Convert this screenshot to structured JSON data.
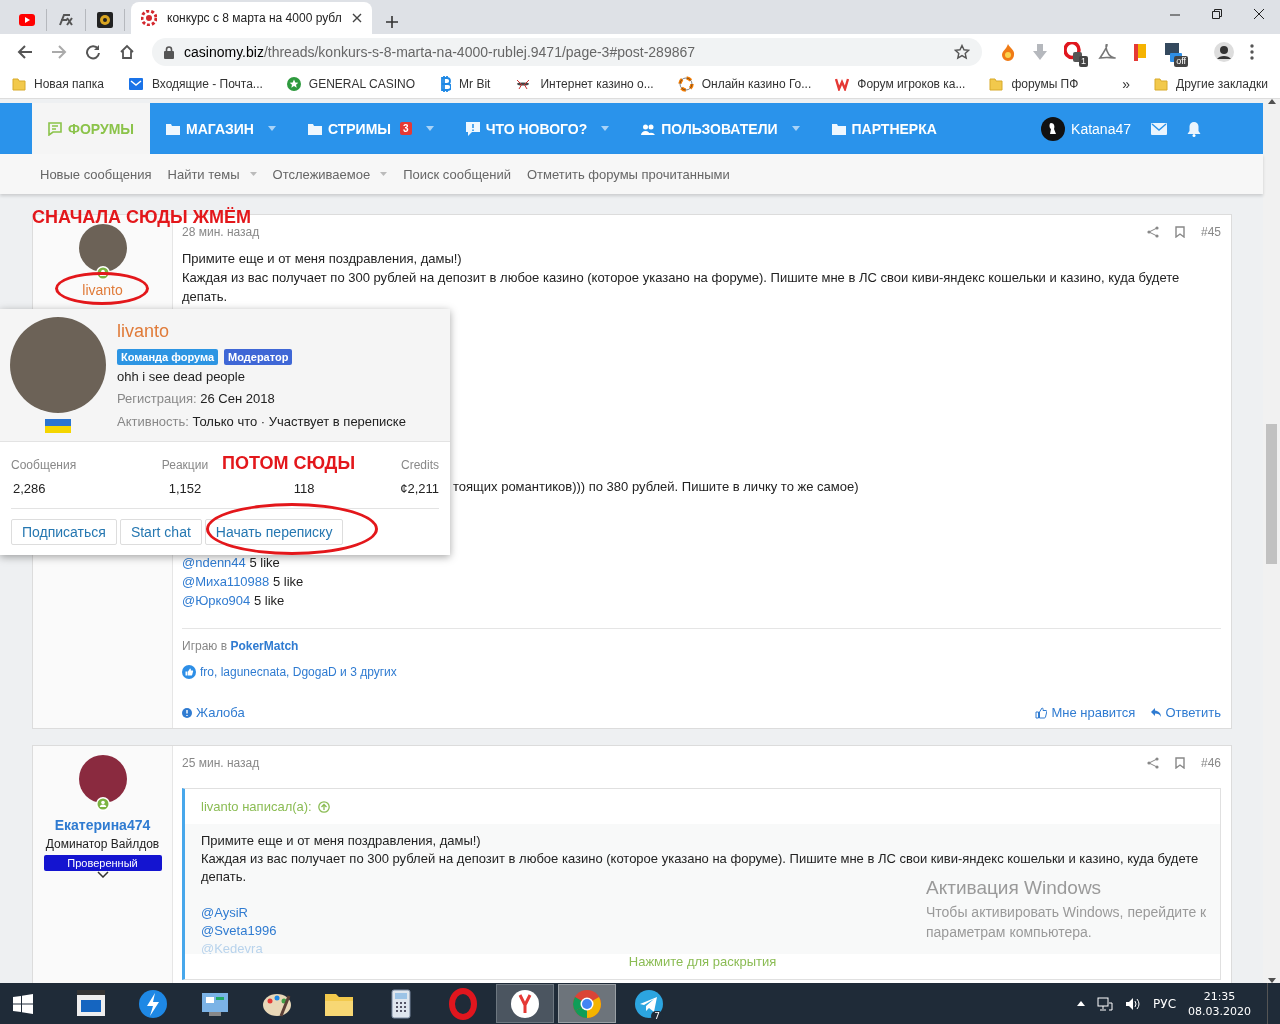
{
  "browser": {
    "tabs": [
      {
        "kind": "youtube",
        "selected": false
      },
      {
        "kind": "fx",
        "selected": false
      },
      {
        "kind": "emblem",
        "selected": false
      },
      {
        "kind": "casino",
        "title": "конкурс с 8 марта на 4000 рубл",
        "selected": true
      }
    ],
    "address": {
      "host": "casinomy.biz",
      "path": "/threads/konkurs-s-8-marta-na-4000-rublej.9471/page-3#post-289867"
    },
    "extensions": [
      {
        "kind": "fire"
      },
      {
        "kind": "download"
      },
      {
        "kind": "opera",
        "badge": "1"
      },
      {
        "kind": "acrobat"
      },
      {
        "kind": "flag"
      },
      {
        "kind": "sh",
        "badge": "off"
      }
    ],
    "bookmarks": [
      {
        "kind": "folder",
        "label": "Новая папка"
      },
      {
        "kind": "mail",
        "label": "Входящие - Почта..."
      },
      {
        "kind": "star",
        "label": "GENERAL CASINO"
      },
      {
        "kind": "bitcoin",
        "label": "Mr Bit"
      },
      {
        "kind": "bug",
        "label": "Интернет казино о..."
      },
      {
        "kind": "ring",
        "label": "Онлайн казино Го..."
      },
      {
        "kind": "w",
        "label": "Форум игроков ка..."
      },
      {
        "kind": "folder",
        "label": "форумы ПФ"
      }
    ],
    "bookmarks_more": "»",
    "other_bookmarks": "Другие закладки"
  },
  "site_nav": {
    "items": [
      {
        "kind": "forum",
        "label": "ФОРУМЫ",
        "selected": true,
        "dropdown": false
      },
      {
        "kind": "folder",
        "label": "МАГАЗИН",
        "selected": false,
        "dropdown": true
      },
      {
        "kind": "folder",
        "label": "СТРИМЫ",
        "badge": "3",
        "selected": false,
        "dropdown": true
      },
      {
        "kind": "alert",
        "label": "ЧТО НОВОГО?",
        "selected": false,
        "dropdown": true
      },
      {
        "kind": "users",
        "label": "ПОЛЬЗОВАТЕЛИ",
        "selected": false,
        "dropdown": true
      },
      {
        "kind": "folder",
        "label": "ПАРТНЕРКА",
        "selected": false,
        "dropdown": false
      }
    ],
    "user": "Katana47"
  },
  "sub_nav": [
    {
      "label": "Новые сообщения",
      "dropdown": false
    },
    {
      "label": "Найти темы",
      "dropdown": true
    },
    {
      "label": "Отслеживаемое",
      "dropdown": true
    },
    {
      "label": "Поиск сообщений",
      "dropdown": false
    },
    {
      "label": "Отметить форумы прочитанными",
      "dropdown": false
    }
  ],
  "posts": [
    {
      "author": "livanto",
      "time": "28 мин. назад",
      "number": "#45",
      "intro": [
        "Примите еще и от меня поздравления, дамы!)",
        "Каждая из вас получает по 300 рублей на депозит в любое казино (которое указано на форуме). Пишите мне в ЛС свои киви-яндекс кошельки и казино, куда будете депать."
      ],
      "partial_line": "тоящих романтиков))) по 380 рублей. Пишите в личку то же самое)",
      "mentions": [
        {
          "user": "@ndenn44",
          "text": "5 like"
        },
        {
          "user": "@Миха110988",
          "text": "5 like"
        },
        {
          "user": "@Юрко904",
          "text": "5 like"
        }
      ],
      "signature": {
        "text": "Играю в",
        "link": "PokerMatch"
      },
      "reactions": "fro, lagunecnata, DgogaD и 3 других",
      "actions": {
        "report": "Жалоба",
        "like": "Мне нравится",
        "reply": "Ответить"
      }
    },
    {
      "author": "Екатерина474",
      "user_title": "Доминатор Вайлдов",
      "banner": "Проверенный",
      "time": "25 мин. назад",
      "number": "#46",
      "quote": {
        "header": "livanto написал(а):",
        "lines": [
          "Примите еще и от меня поздравления, дамы!)",
          "Каждая из вас получает по 300 рублей на депозит в любое казино (которое указано на форуме). Пишите мне в ЛС свои киви-яндекс кошельки и казино, куда будете депать."
        ],
        "mentions": [
          "@AysiR",
          "@Sveta1996",
          "@Kedevra"
        ],
        "expand": "Нажмите для раскрытия"
      }
    }
  ],
  "member_popup": {
    "name": "livanto",
    "badges": [
      {
        "label": "Команда форума",
        "color": "#2d95e3"
      },
      {
        "label": "Модератор",
        "color": "#3f67d6"
      }
    ],
    "status": "ohh i see dead people",
    "registration": {
      "label": "Регистрация:",
      "value": "26 Сен 2018"
    },
    "activity": {
      "label": "Активность:",
      "value": "Только что · Участвует в переписке"
    },
    "stats": [
      {
        "label": "Сообщения",
        "value": "2,286"
      },
      {
        "label": "Реакции",
        "value": "1,152"
      },
      {
        "value": "118"
      },
      {
        "label": "Credits",
        "value": "¢2,211"
      }
    ],
    "buttons": [
      "Подписаться",
      "Start chat",
      "Начать переписку"
    ]
  },
  "annotations": [
    "СНАЧАЛА СЮДЫ ЖМЁМ",
    "ПОТОМ СЮДЫ"
  ],
  "windows_notice": {
    "title": "Активация Windows",
    "text": "Чтобы активировать Windows, перейдите к параметрам компьютера."
  },
  "taskbar": {
    "apps": [
      {
        "kind": "media",
        "open": false,
        "selected": false
      },
      {
        "kind": "bolt",
        "open": false,
        "selected": false
      },
      {
        "kind": "panel",
        "open": false,
        "selected": false
      },
      {
        "kind": "paint",
        "open": false,
        "selected": false
      },
      {
        "kind": "explorer",
        "open": false,
        "selected": false
      },
      {
        "kind": "calc",
        "open": false,
        "selected": false
      },
      {
        "kind": "opera",
        "open": false,
        "selected": false
      },
      {
        "kind": "yandex",
        "open": true,
        "selected": false
      },
      {
        "kind": "chrome",
        "open": true,
        "selected": true
      },
      {
        "kind": "telegram",
        "badge": "7",
        "open": false,
        "selected": false
      }
    ],
    "language": "РУС",
    "time": "21:35",
    "date": "08.03.2020"
  }
}
